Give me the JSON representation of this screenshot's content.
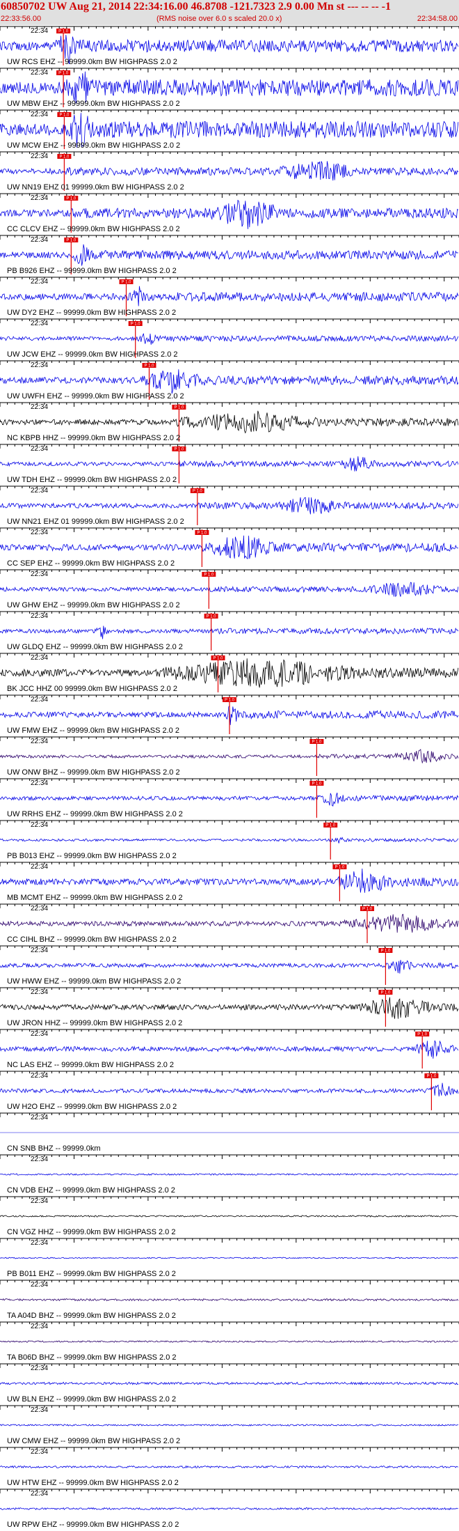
{
  "header": {
    "title": "60850702 UW Aug 21, 2014 22:34:16.00   46.8708 -121.7323  2.9 0.00 Mn st --- -- --   -1",
    "start_time": "22:33:56.00",
    "note": "(RMS noise over 6.0 s scaled 20.0 x)",
    "end_time": "22:34:58.00"
  },
  "time_label": "22:34",
  "pick_label": "P 1.0",
  "colors": {
    "blue": "#0000e6",
    "black": "#000000",
    "purple": "#2b006b",
    "red": "#e00000",
    "header_bg": "#e0e0e0"
  },
  "traces": [
    {
      "label": "UW RCS EHZ -- 99999.0km BW  HIGHPASS  2.0  2",
      "color": "blue",
      "amp": 22,
      "pick": 0.138,
      "burst": [
        0.12,
        0.18
      ]
    },
    {
      "label": "UW MBW EHZ -- 99999.0km BW  HIGHPASS  2.0  2",
      "color": "blue",
      "amp": 30,
      "pick": 0.138,
      "burst": [
        0.15,
        0.2
      ]
    },
    {
      "label": "UW MCW EHZ -- 99999.0km BW  HIGHPASS  2.0  2",
      "color": "blue",
      "amp": 30,
      "pick": 0.14,
      "burst": [
        0.15,
        0.2
      ]
    },
    {
      "label": "UW NN19 EHZ 01 99999.0km BW  HIGHPASS  2.0  2",
      "color": "blue",
      "amp": 14,
      "pick": 0.14,
      "burst": [
        0.6,
        0.78
      ]
    },
    {
      "label": "CC CLCV EHZ -- 99999.0km BW  HIGHPASS  2.0  2",
      "color": "blue",
      "amp": 18,
      "pick": 0.155,
      "burst": [
        0.45,
        0.63
      ]
    },
    {
      "label": "PB B926 EHZ -- 99999.0km BW  HIGHPASS  2.0  2",
      "color": "blue",
      "amp": 16,
      "pick": 0.155,
      "burst": [
        0.16,
        0.2
      ]
    },
    {
      "label": "UW DY2 EHZ -- 99999.0km BW  HIGHPASS  2.0  2",
      "color": "blue",
      "amp": 16,
      "pick": 0.275,
      "burst": [
        0.29,
        0.31
      ]
    },
    {
      "label": "UW JCW EHZ -- 99999.0km BW  HIGHPASS  2.0  2",
      "color": "blue",
      "amp": 10,
      "pick": 0.295,
      "burst": [
        0.3,
        0.34
      ]
    },
    {
      "label": "UW UWFH EHZ -- 99999.0km BW  HIGHPASS  2.0  2",
      "color": "blue",
      "amp": 16,
      "pick": 0.325,
      "burst": [
        0.31,
        0.45
      ]
    },
    {
      "label": "NC KBPB HHZ -- 99999.0km BW  HIGHPASS  2.0  2",
      "color": "black",
      "amp": 14,
      "pick": 0.39,
      "burst": [
        0.38,
        0.7
      ]
    },
    {
      "label": "UW TDH EHZ -- 99999.0km BW  HIGHPASS  2.0  2",
      "color": "blue",
      "amp": 10,
      "pick": 0.39,
      "burst": [
        0.74,
        0.82
      ]
    },
    {
      "label": "UW NN21 EHZ 01 99999.0km BW  HIGHPASS  2.0  2",
      "color": "blue",
      "amp": 12,
      "pick": 0.43,
      "burst": [
        0.6,
        0.76
      ]
    },
    {
      "label": "CC SEP EHZ -- 99999.0km BW  HIGHPASS  2.0  2",
      "color": "blue",
      "amp": 16,
      "pick": 0.44,
      "burst": [
        0.45,
        0.6
      ]
    },
    {
      "label": "UW GHW EHZ -- 99999.0km BW  HIGHPASS  2.0  2",
      "color": "blue",
      "amp": 10,
      "pick": 0.455,
      "burst": [
        0.8,
        0.96
      ]
    },
    {
      "label": "UW GLDQ EHZ -- 99999.0km BW  HIGHPASS  2.0  2",
      "color": "blue",
      "amp": 10,
      "pick": 0.46,
      "burst": [
        0.21,
        0.24
      ]
    },
    {
      "label": "BK JCC HHZ 00 99999.0km BW  HIGHPASS  2.0  2",
      "color": "black",
      "amp": 18,
      "pick": 0.475,
      "burst": [
        0.34,
        0.8
      ]
    },
    {
      "label": "UW FMW EHZ -- 99999.0km BW  HIGHPASS  2.0  2",
      "color": "blue",
      "amp": 14,
      "pick": 0.5,
      "burst": [
        0.49,
        0.52
      ]
    },
    {
      "label": "UW ONW BHZ -- 99999.0km BW  HIGHPASS  2.0  2",
      "color": "purple",
      "amp": 8,
      "pick": 0.69,
      "burst": [
        0.85,
        0.99
      ]
    },
    {
      "label": "UW RRHS EHZ -- 99999.0km BW  HIGHPASS  2.0  2",
      "color": "blue",
      "amp": 10,
      "pick": 0.69,
      "burst": [
        0.7,
        0.75
      ]
    },
    {
      "label": "PB B013 EHZ -- 99999.0km BW  HIGHPASS  2.0  2",
      "color": "blue",
      "amp": 6,
      "pick": 0.72,
      "burst": [
        0.72,
        0.76
      ]
    },
    {
      "label": "MB MCMT EHZ -- 99999.0km BW  HIGHPASS  2.0  2",
      "color": "blue",
      "amp": 16,
      "pick": 0.74,
      "burst": [
        0.73,
        0.86
      ]
    },
    {
      "label": "CC CIHL BHZ -- 99999.0km BW  HIGHPASS  2.0  2",
      "color": "purple",
      "amp": 12,
      "pick": 0.8,
      "burst": [
        0.75,
        0.99
      ]
    },
    {
      "label": "UW HWW EHZ -- 99999.0km BW  HIGHPASS  2.0  2",
      "color": "blue",
      "amp": 10,
      "pick": 0.84,
      "burst": [
        0.84,
        0.9
      ]
    },
    {
      "label": "UW JRON HHZ -- 99999.0km BW  HIGHPASS  2.0  2",
      "color": "black",
      "amp": 14,
      "pick": 0.84,
      "burst": [
        0.78,
        0.95
      ]
    },
    {
      "label": "NC LAS EHZ -- 99999.0km BW  HIGHPASS  2.0  2",
      "color": "blue",
      "amp": 12,
      "pick": 0.92,
      "burst": [
        0.9,
        0.99
      ]
    },
    {
      "label": "UW H2O EHZ -- 99999.0km BW  HIGHPASS  2.0  2",
      "color": "blue",
      "amp": 10,
      "pick": 0.94,
      "burst": [
        0.93,
        0.99
      ]
    },
    {
      "label": "CN SNB BHZ -- 99999.0km",
      "color": "blue",
      "amp": 0,
      "pick": null,
      "burst": null
    },
    {
      "label": "CN VDB EHZ -- 99999.0km BW  HIGHPASS  2.0  2",
      "color": "blue",
      "amp": 4,
      "pick": null,
      "burst": null
    },
    {
      "label": "CN VGZ HHZ -- 99999.0km BW  HIGHPASS  2.0  2",
      "color": "black",
      "amp": 4,
      "pick": null,
      "burst": null
    },
    {
      "label": "PB B011 EHZ -- 99999.0km BW  HIGHPASS  2.0  2",
      "color": "blue",
      "amp": 3,
      "pick": null,
      "burst": null
    },
    {
      "label": "TA A04D BHZ -- 99999.0km BW  HIGHPASS  2.0  2",
      "color": "purple",
      "amp": 5,
      "pick": null,
      "burst": null
    },
    {
      "label": "TA B06D BHZ -- 99999.0km BW  HIGHPASS  2.0  2",
      "color": "purple",
      "amp": 4,
      "pick": null,
      "burst": null
    },
    {
      "label": "UW BLN EHZ -- 99999.0km BW  HIGHPASS  2.0  2",
      "color": "blue",
      "amp": 6,
      "pick": null,
      "burst": null
    },
    {
      "label": "UW CMW EHZ -- 99999.0km BW  HIGHPASS  2.0  2",
      "color": "blue",
      "amp": 4,
      "pick": null,
      "burst": null
    },
    {
      "label": "UW HTW EHZ -- 99999.0km BW  HIGHPASS  2.0  2",
      "color": "blue",
      "amp": 5,
      "pick": null,
      "burst": null
    },
    {
      "label": "UW RPW EHZ -- 99999.0km BW  HIGHPASS  2.0  2",
      "color": "blue",
      "amp": 5,
      "pick": null,
      "burst": null
    }
  ]
}
